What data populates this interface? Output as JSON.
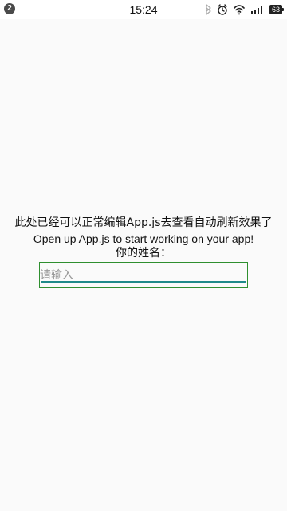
{
  "status_bar": {
    "notification_count": "2",
    "time": "15:24",
    "battery": "63",
    "icons": [
      "bluetooth-icon",
      "alarm-icon",
      "wifi-icon",
      "signal-icon",
      "battery-icon"
    ]
  },
  "main": {
    "welcome_text": "此处已经可以正常编辑App.js去查看自动刷新效果了",
    "instructions_text": "Open up App.js to start working on your app!",
    "name_label": "你的姓名：",
    "name_input": {
      "placeholder": "请输入",
      "value": ""
    }
  },
  "colors": {
    "background": "#fafafa",
    "input_border": "#2f8f2f",
    "underline": "#1f8a8a"
  }
}
